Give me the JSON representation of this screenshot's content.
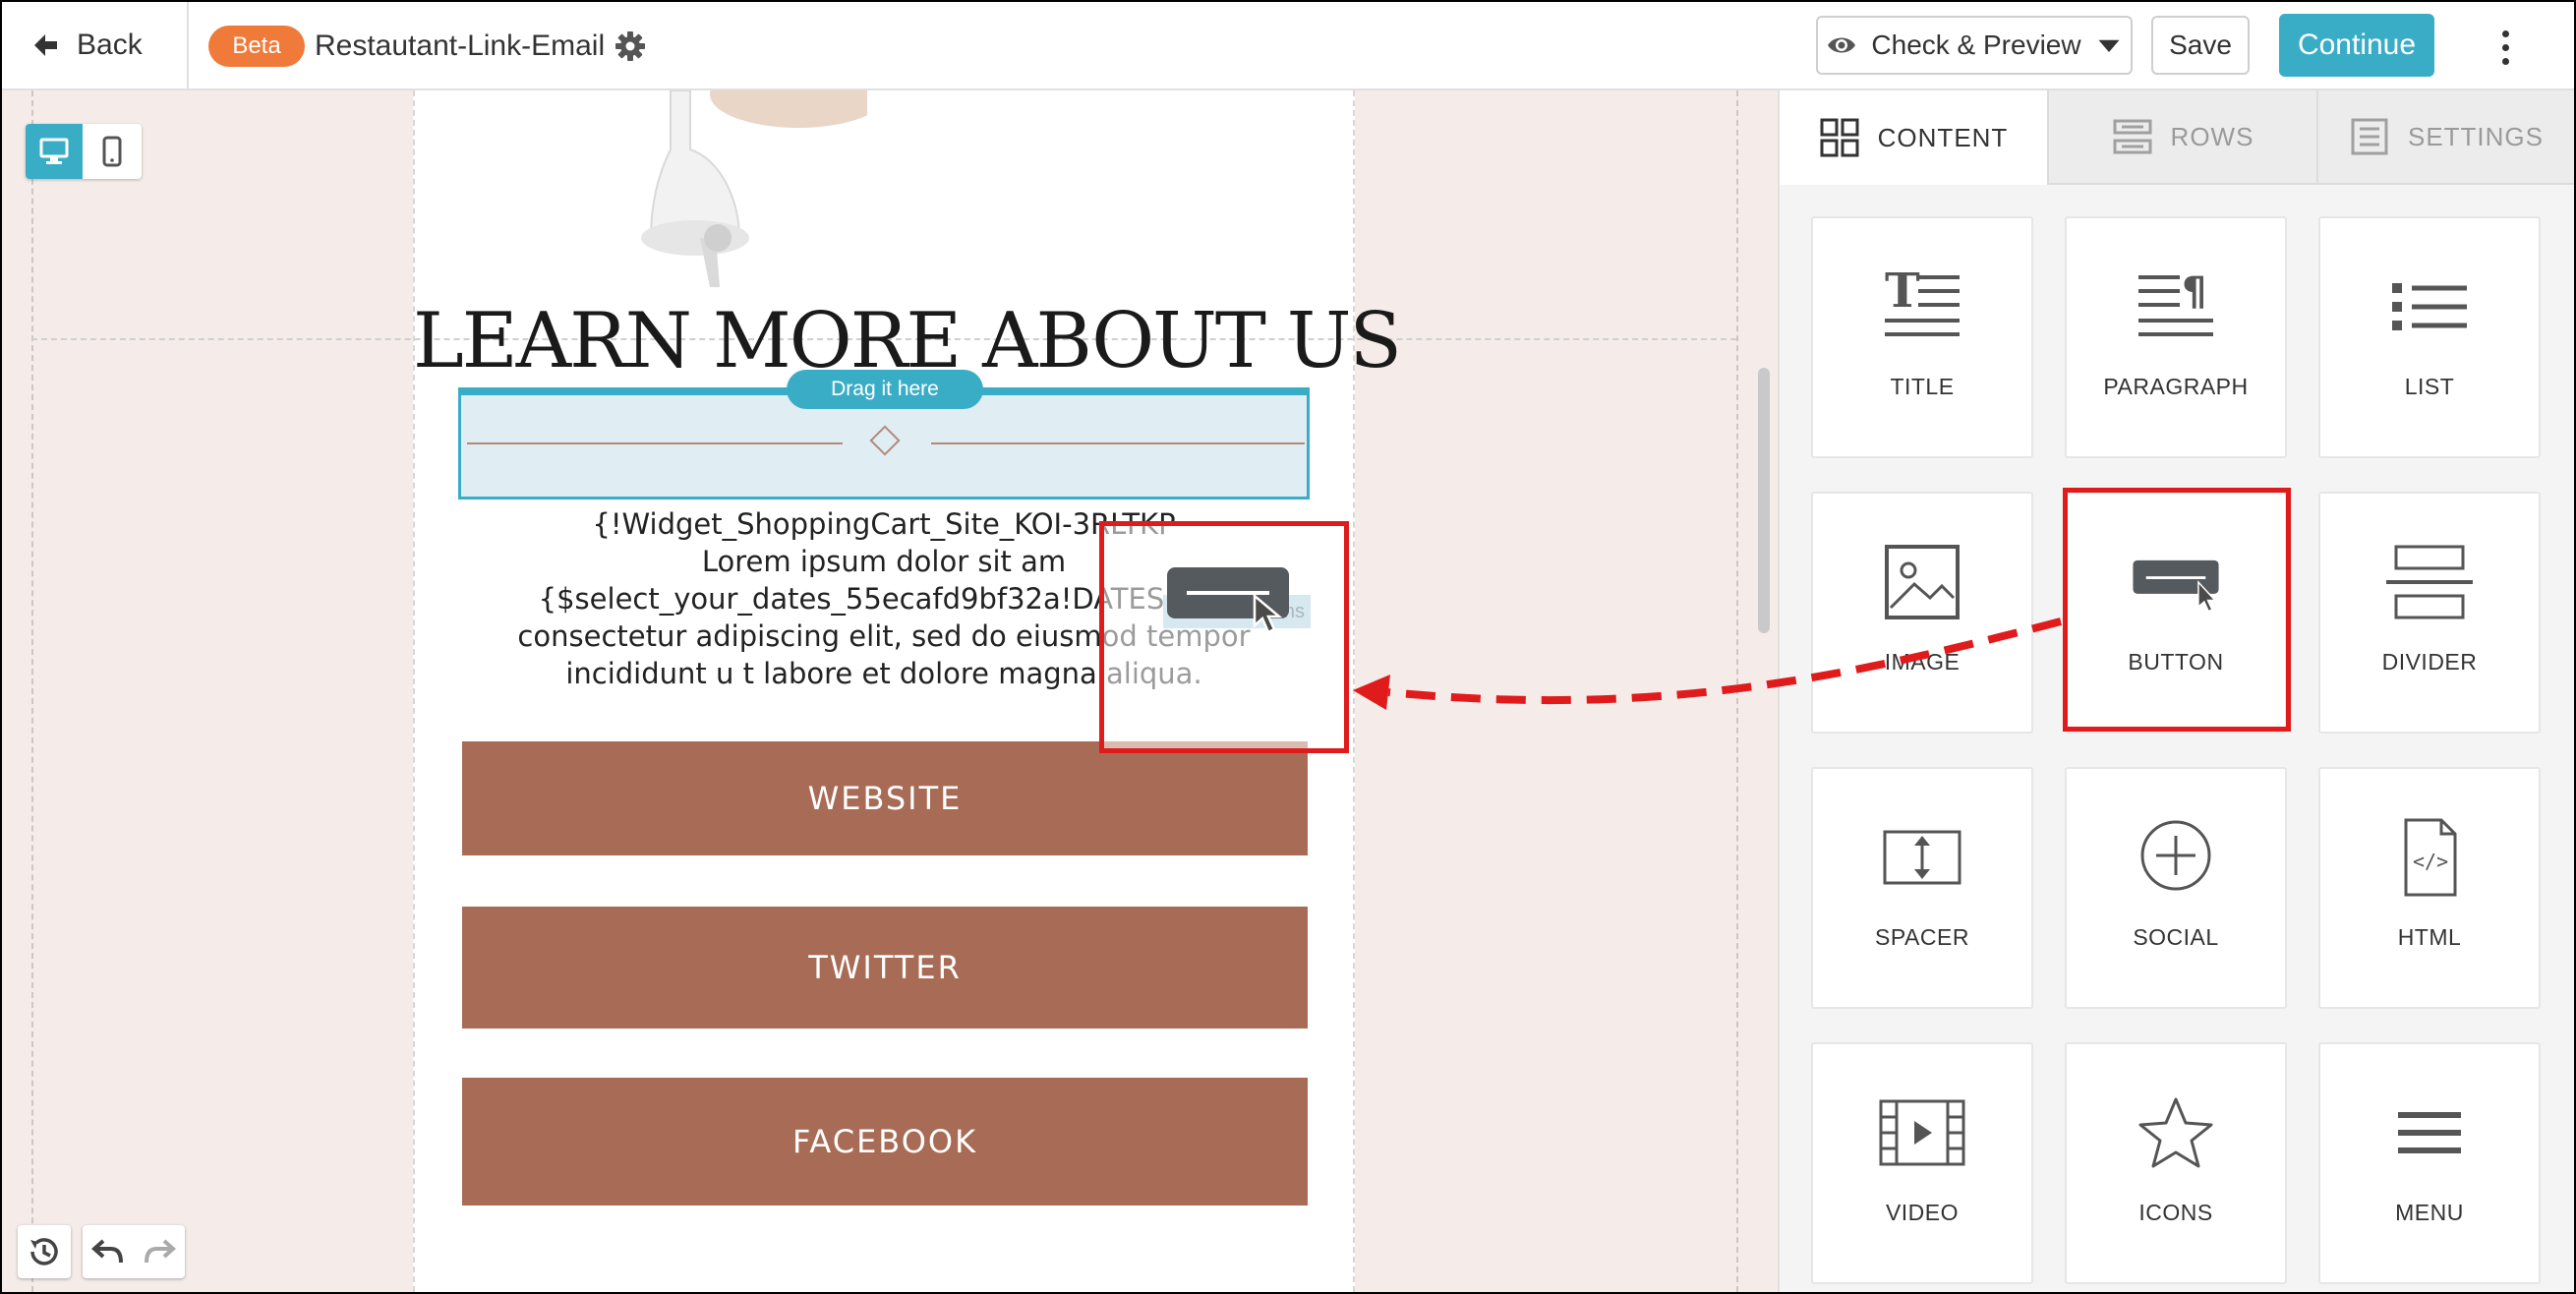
{
  "topbar": {
    "back_label": "Back",
    "beta_label": "Beta",
    "email_name": "Restautant-Link-Email",
    "preview_label": "Check & Preview",
    "save_label": "Save",
    "continue_label": "Continue"
  },
  "canvas": {
    "headline": "LEARN MORE ABOUT US",
    "drag_hint": "Drag it here",
    "body_text_lines": [
      "{!Widget_ShoppingCart_Site_KOI-3RLTKP",
      "Lorem ipsum dolor sit am",
      "{$select_your_dates_55ecafd9bf32a!DATES} et,",
      "consectetur adipiscing elit, sed do eiusmod tempor",
      "incididunt u t labore et dolore magna aliqua."
    ],
    "ghost_hint": "Ins",
    "buttons": [
      "WEBSITE",
      "TWITTER",
      "FACEBOOK"
    ]
  },
  "panel": {
    "tabs": [
      "CONTENT",
      "ROWS",
      "SETTINGS"
    ],
    "active_tab": "CONTENT",
    "tiles": [
      "TITLE",
      "PARAGRAPH",
      "LIST",
      "IMAGE",
      "BUTTON",
      "DIVIDER",
      "SPACER",
      "SOCIAL",
      "HTML",
      "VIDEO",
      "ICONS",
      "MENU"
    ]
  },
  "colors": {
    "accent": "#3aadc6",
    "beta_badge": "#f07a3a",
    "email_button": "#a86b55",
    "canvas_bg": "#f5ece9",
    "annotation": "#e01b1b"
  }
}
